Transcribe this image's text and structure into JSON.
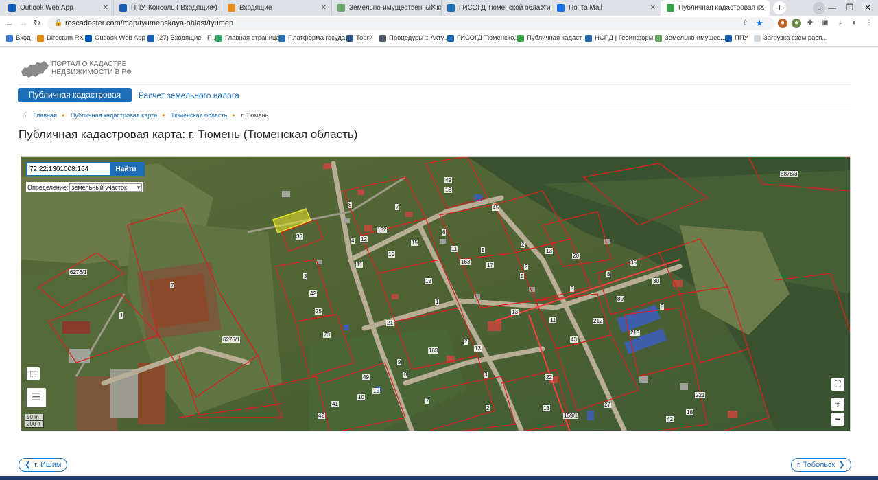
{
  "browser": {
    "tabs": [
      {
        "title": "Outlook Web App",
        "color": "#0b5cb8"
      },
      {
        "title": "ППУ. Консоль ( Входящие )",
        "color": "#1a5fb4"
      },
      {
        "title": "Входящие",
        "color": "#e48a1e"
      },
      {
        "title": "Земельно-имущественный ком",
        "color": "#6aa86b"
      },
      {
        "title": "ГИСОГД Тюменской области",
        "color": "#1e6fb8"
      },
      {
        "title": "Почта Mail",
        "color": "#1a73e8"
      },
      {
        "title": "Публичная кадастровая карта г.",
        "color": "#3aa44d"
      }
    ],
    "url": "roscadaster.com/map/tyumenskaya-oblast/tyumen",
    "bookmarks": [
      "Вход",
      "Directum RX",
      "Outlook Web App",
      "(27) Входящие - П...",
      "Главная страница",
      "Платформа госуда...",
      "Торги",
      "Процедуры :: Акту...",
      "ГИСОГД Тюменско...",
      "Публичная кадаст...",
      "НСПД | Геоинформ...",
      "Земельно-имущес...",
      "ППУ",
      "Загрузка схем расп..."
    ]
  },
  "logo": {
    "line1": "ПОРТАЛ О КАДАСТРЕ",
    "line2": "НЕДВИЖИМОСТИ В РФ"
  },
  "menu": {
    "active": "Публичная кадастровая карта",
    "link": "Расчет земельного налога"
  },
  "breadcrumbs": [
    "Главная",
    "Публичная кадастровая карта",
    "Тюменская область",
    "г. Тюмень"
  ],
  "page_title": "Публичная кадастровая карта: г. Тюмень (Тюменская область)",
  "map": {
    "search_value": "72:22:1301008:164",
    "search_button": "Найти",
    "definition_label": "Определение:",
    "definition_value": "земельный участок",
    "scale_m": "50 m",
    "scale_ft": "200 ft",
    "zoom_in": "+",
    "zoom_out": "−",
    "plot_labels": [
      "49",
      "16",
      "5878/3",
      "8",
      "7",
      "45",
      "132",
      "36",
      "4",
      "12",
      "15",
      "6",
      "8",
      "2",
      "13",
      "20",
      "11",
      "10",
      "11",
      "163",
      "17",
      "2",
      "35",
      "6276/1",
      "3",
      "7",
      "12",
      "8",
      "1",
      "5",
      "80",
      "30",
      "42",
      "25",
      "1",
      "3",
      "212",
      "213",
      "6",
      "13",
      "11",
      "21",
      "73",
      "2",
      "6276/1",
      "163",
      "9",
      "13",
      "2",
      "8",
      "49",
      "3",
      "43",
      "22",
      "10",
      "15",
      "42",
      "41",
      "7",
      "2",
      "13",
      "159/1",
      "27",
      "18",
      "221",
      "42"
    ]
  },
  "pager": {
    "prev": "г. Ишим",
    "next": "г. Тобольск"
  }
}
